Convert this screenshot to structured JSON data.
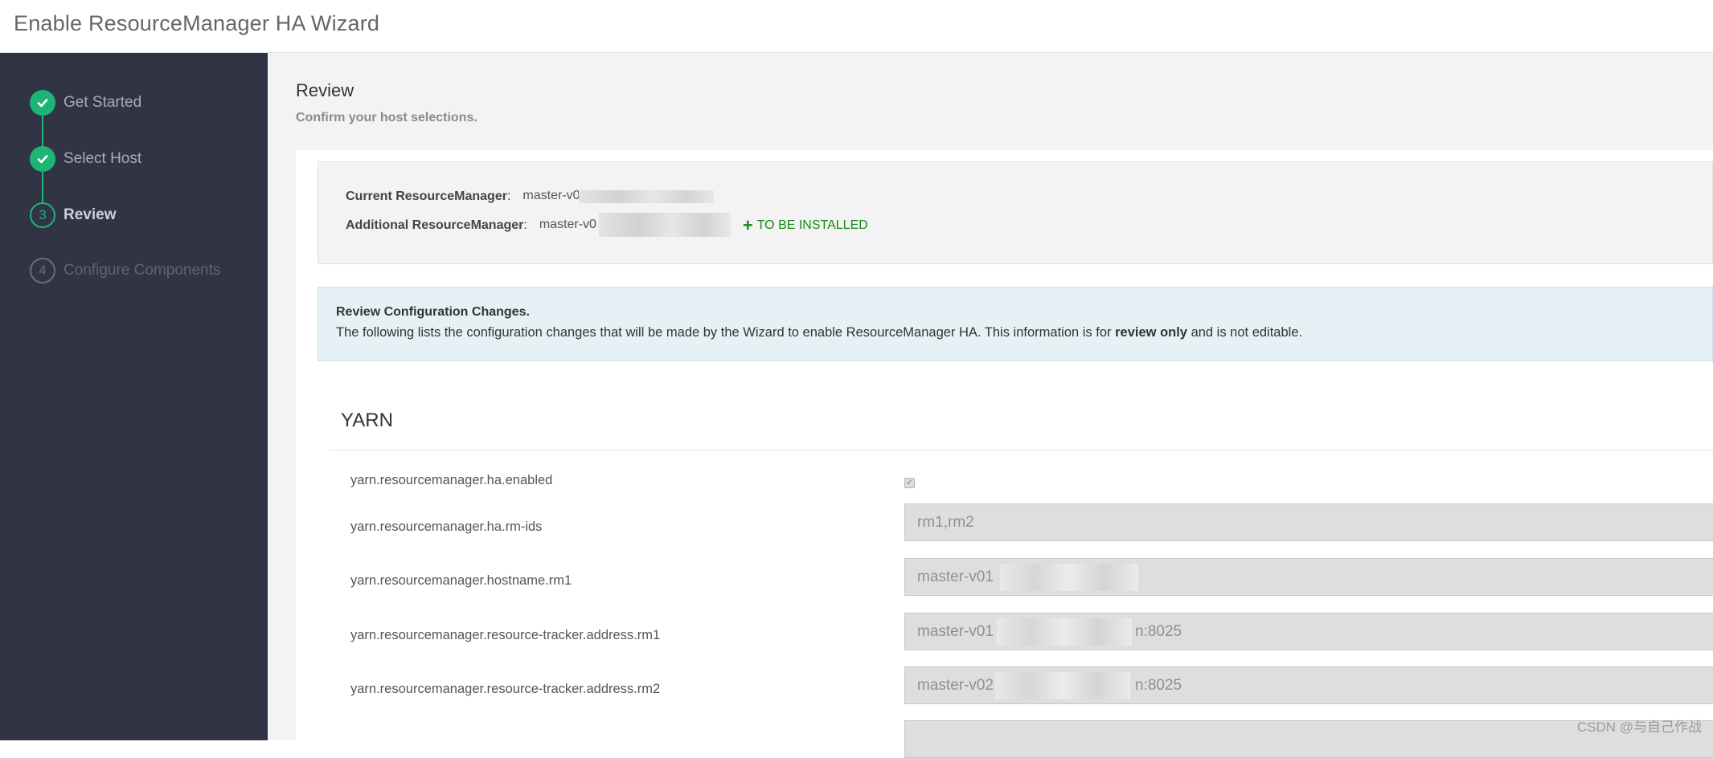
{
  "header": {
    "title": "Enable ResourceManager HA Wizard"
  },
  "steps": [
    {
      "number": "1",
      "label": "Get Started",
      "state": "done"
    },
    {
      "number": "2",
      "label": "Select Host",
      "state": "done"
    },
    {
      "number": "3",
      "label": "Review",
      "state": "current"
    },
    {
      "number": "4",
      "label": "Configure Components",
      "state": "pending"
    }
  ],
  "review": {
    "title": "Review",
    "subtitle": "Confirm your host selections."
  },
  "hosts": {
    "current_label": "Current ResourceManager",
    "current_value": "master-v0",
    "additional_label": "Additional ResourceManager",
    "additional_value": "master-v0",
    "colon": ":",
    "install_label": "TO BE INSTALLED"
  },
  "info": {
    "title": "Review Configuration Changes.",
    "text_before": "The following lists the configuration changes that will be made by the Wizard to enable ResourceManager HA. This information is for ",
    "text_bold": "review only",
    "text_after": " and is not editable."
  },
  "yarn": {
    "section_title": "YARN",
    "properties": [
      {
        "name": "yarn.resourcemanager.ha.enabled",
        "type": "checkbox",
        "checked": true
      },
      {
        "name": "yarn.resourcemanager.ha.rm-ids",
        "type": "text",
        "value": "rm1,rm2"
      },
      {
        "name": "yarn.resourcemanager.hostname.rm1",
        "type": "text",
        "value": "master-v01"
      },
      {
        "name": "yarn.resourcemanager.resource-tracker.address.rm1",
        "type": "text",
        "value": "master-v01",
        "suffix": "n:8025"
      },
      {
        "name": "yarn.resourcemanager.resource-tracker.address.rm2",
        "type": "text",
        "value": "master-v02",
        "suffix": "n:8025"
      }
    ]
  },
  "watermark": "CSDN @与自己作战",
  "colors": {
    "sidebar_bg": "#313445",
    "accent_green": "#1eb475",
    "install_green": "#1a8a1a",
    "info_bg": "#e6f1f6"
  }
}
